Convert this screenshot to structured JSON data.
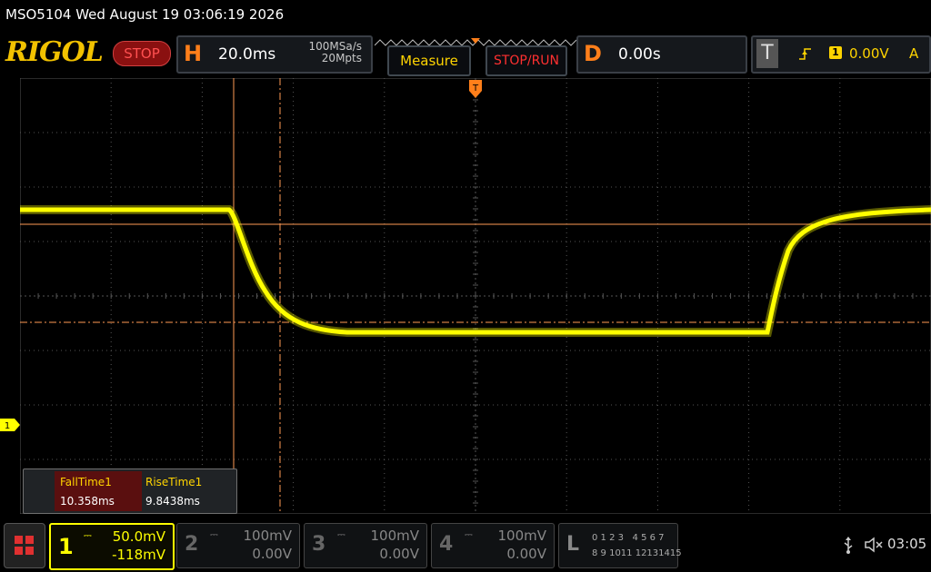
{
  "status": {
    "text": "MSO5104  Wed August 19 03:06:19 2026"
  },
  "toolbar": {
    "logo": "RIGOL",
    "run_state": "STOP",
    "horizontal": {
      "letter": "H",
      "timebase": "20.0ms",
      "sample_rate": "100MSa/s",
      "mem_depth": "20Mpts"
    },
    "measure_label": "Measure",
    "stoprun_label": "STOP/RUN",
    "delay": {
      "letter": "D",
      "value": "0.00s"
    },
    "trigger": {
      "letter": "T",
      "source": "1",
      "level": "0.00V",
      "mode": "A"
    }
  },
  "screen": {
    "channel1_marker": "1",
    "trigger_marker": "T"
  },
  "measurements": {
    "headers": [
      "FallTime1",
      "RiseTime1"
    ],
    "values": [
      "10.358ms",
      "9.8438ms"
    ]
  },
  "channels": [
    {
      "num": "1",
      "scale": "50.0mV",
      "offset": "-118mV",
      "active": true
    },
    {
      "num": "2",
      "scale": "100mV",
      "offset": "0.00V",
      "active": false
    },
    {
      "num": "3",
      "scale": "100mV",
      "offset": "0.00V",
      "active": false
    },
    {
      "num": "4",
      "scale": "100mV",
      "offset": "0.00V",
      "active": false
    }
  ],
  "logic": {
    "letter": "L",
    "row1": "0 1 2 3   4 5 6 7",
    "row2": "8 9 1011 12131415"
  },
  "clock": "03:05",
  "colors": {
    "ch1": "#ffff00",
    "accent": "#ff7f1a",
    "grid": "#555555",
    "cursor": "#ff9a55"
  }
}
